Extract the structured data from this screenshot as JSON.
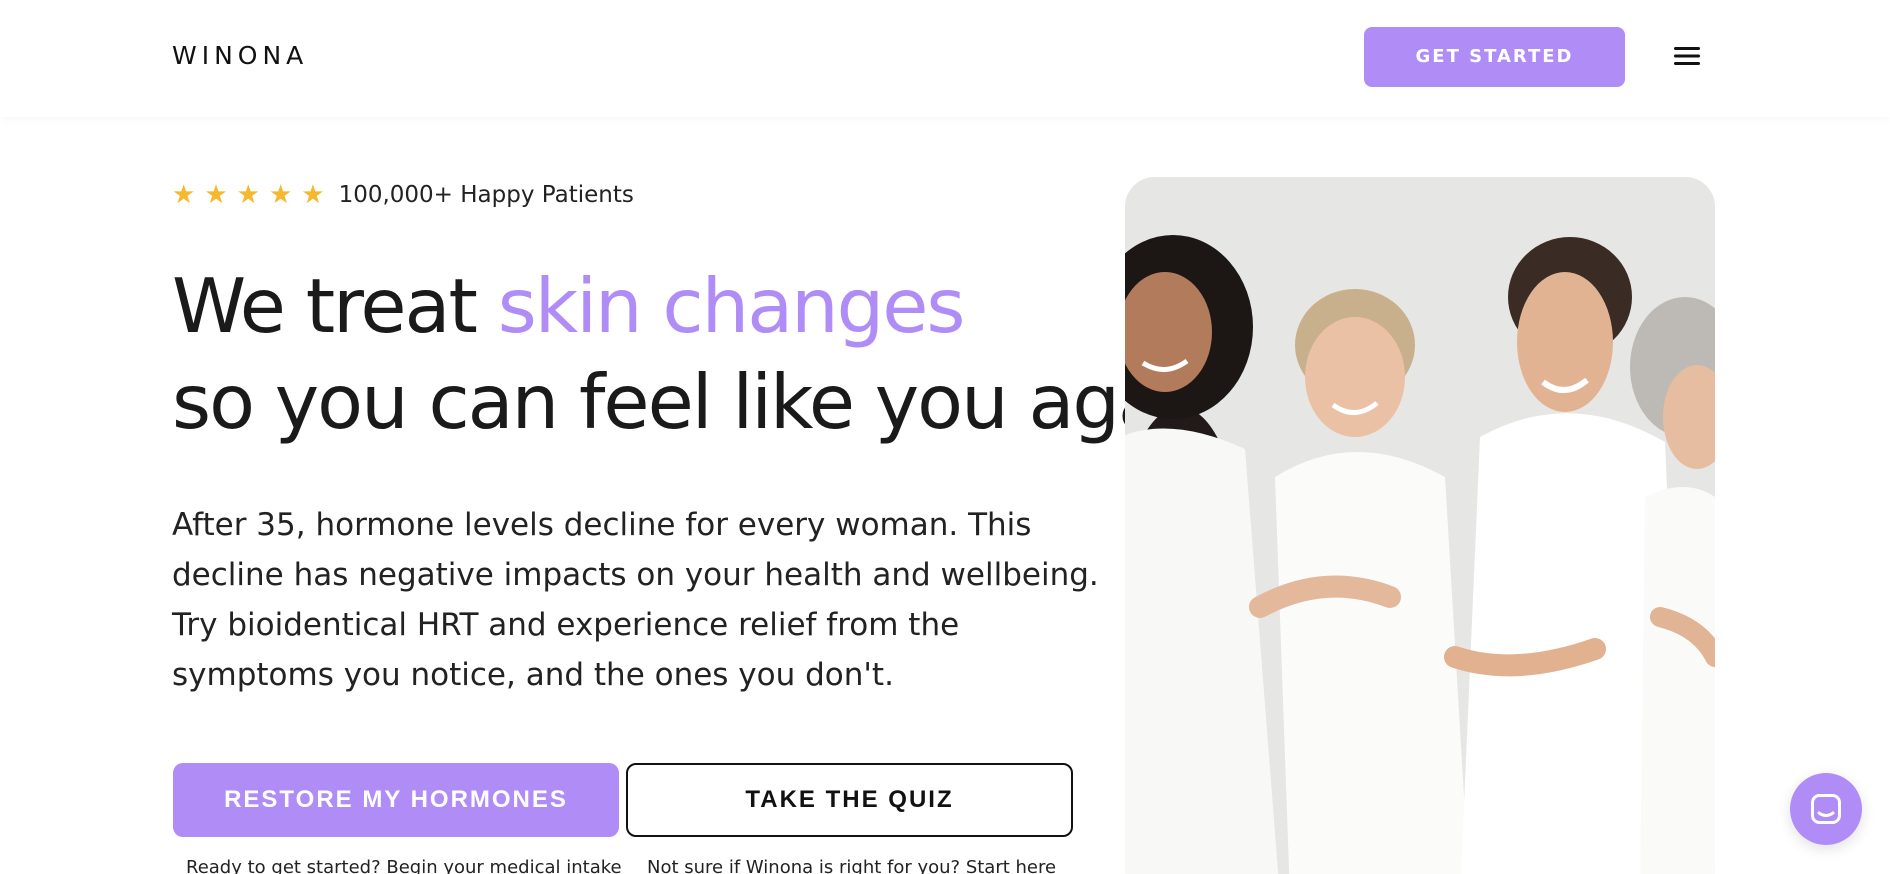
{
  "header": {
    "logo": "WINONA",
    "cta_label": "GET STARTED",
    "menu_icon": "hamburger-menu-icon"
  },
  "hero": {
    "rating": {
      "stars": 5,
      "star_icon": "star-icon",
      "text": "100,000+ Happy Patients"
    },
    "headline": {
      "prefix": "We treat ",
      "highlight": "skin changes",
      "line2": "so you can feel like you again."
    },
    "description": "After 35, hormone levels decline for every woman. This decline has negative impacts on your health and wellbeing. Try bioidentical HRT and experience relief from the symptoms you notice, and the ones you don't.",
    "primary_button": "RESTORE MY HORMONES",
    "secondary_button": "TAKE THE QUIZ",
    "primary_caption": "Ready to get started? Begin your medical intake",
    "secondary_caption": "Not sure if Winona is right for you? Start here"
  },
  "chat": {
    "icon": "chat-icon"
  },
  "colors": {
    "accent": "#b08cf7",
    "star": "#f5b82e",
    "text": "#1a1a1a",
    "photo_background": "#e6e6e4"
  }
}
